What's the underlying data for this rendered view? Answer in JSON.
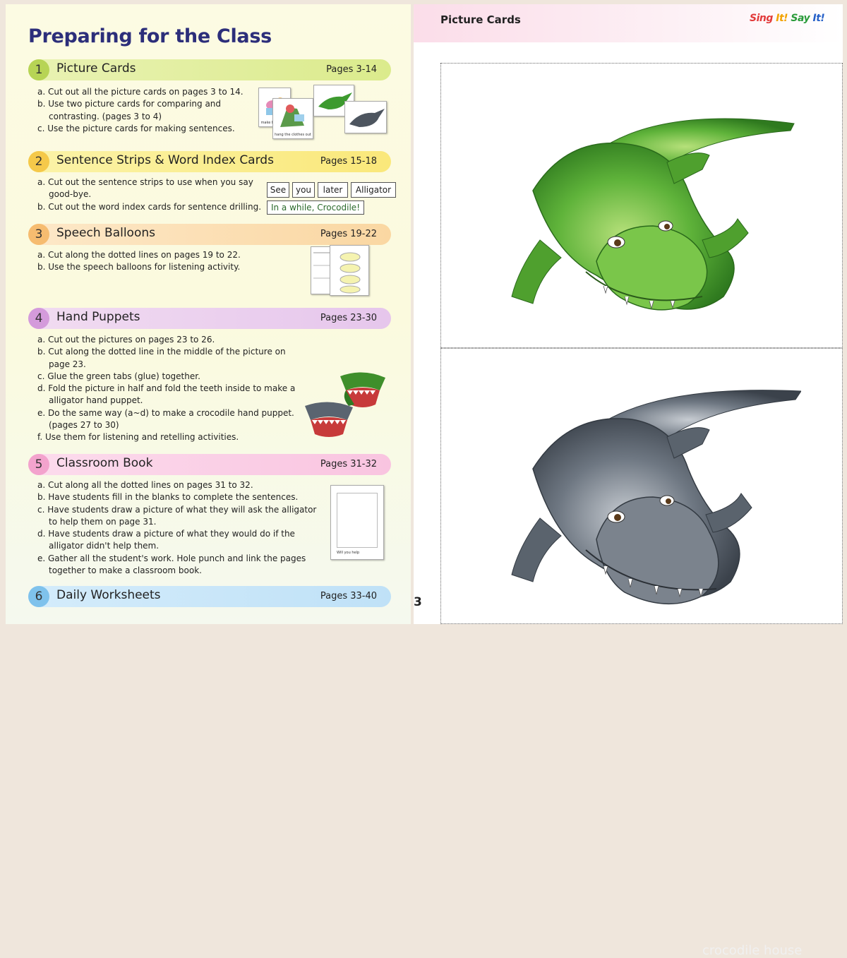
{
  "left": {
    "title": "Preparing for the Class",
    "sections": [
      {
        "num": "1",
        "title": "Picture Cards",
        "pages": "Pages 3-14",
        "items": [
          "a. Cut out all the picture cards on pages 3 to 14.",
          "b. Use two picture cards for comparing and contrasting. (pages 3 to 4)",
          "c. Use the picture cards for making sentences."
        ],
        "thumb_captions": [
          "make breakfast",
          "hang the clothes out"
        ]
      },
      {
        "num": "2",
        "title": "Sentence Strips & Word Index Cards",
        "pages": "Pages 15-18",
        "items": [
          "a. Cut out the sentence strips to use when you say good-bye.",
          "b. Cut out the word index cards for sentence drilling."
        ],
        "words": [
          "See",
          "you",
          "later",
          "Alligator"
        ],
        "strip": "In a while, Crocodile!"
      },
      {
        "num": "3",
        "title": "Speech Balloons",
        "pages": "Pages 19-22",
        "items": [
          "a. Cut along the dotted lines on pages 19 to 22.",
          "b. Use the speech balloons for listening activity."
        ]
      },
      {
        "num": "4",
        "title": "Hand Puppets",
        "pages": "Pages 23-30",
        "items": [
          "a. Cut out the pictures on pages 23 to 26.",
          "b. Cut along the dotted line in the middle of the picture on page 23.",
          "c. Glue the green tabs (glue) together.",
          "d. Fold the picture in half and fold the teeth inside to make a alligator hand puppet.",
          "e. Do the same way (a~d) to make a crocodile hand puppet. (pages 27 to 30)",
          "f. Use them for listening and retelling activities."
        ]
      },
      {
        "num": "5",
        "title": "Classroom Book",
        "pages": "Pages 31-32",
        "items": [
          "a. Cut along all the dotted lines on pages 31 to 32.",
          "b. Have students fill in the blanks to complete the sentences.",
          "c. Have students draw a picture of what they will ask the alligator to help them on page 31.",
          "d. Have students draw a picture of what they would do if the alligator didn't help them.",
          "e. Gather all the student's work. Hole punch and link the pages together to make a classroom book."
        ],
        "book_caption": "Will you help"
      },
      {
        "num": "6",
        "title": "Daily Worksheets",
        "pages": "Pages 33-40"
      }
    ],
    "page_number": "3"
  },
  "right": {
    "header": "Picture Cards",
    "logo": [
      "Sing",
      " It!",
      " Say",
      " It!"
    ],
    "footer_ghost": "crocodile house"
  },
  "colors": {
    "title_navy": "#2c2e7a",
    "alligator_green": "#4caf2f",
    "crocodile_gray": "#5a6470"
  }
}
